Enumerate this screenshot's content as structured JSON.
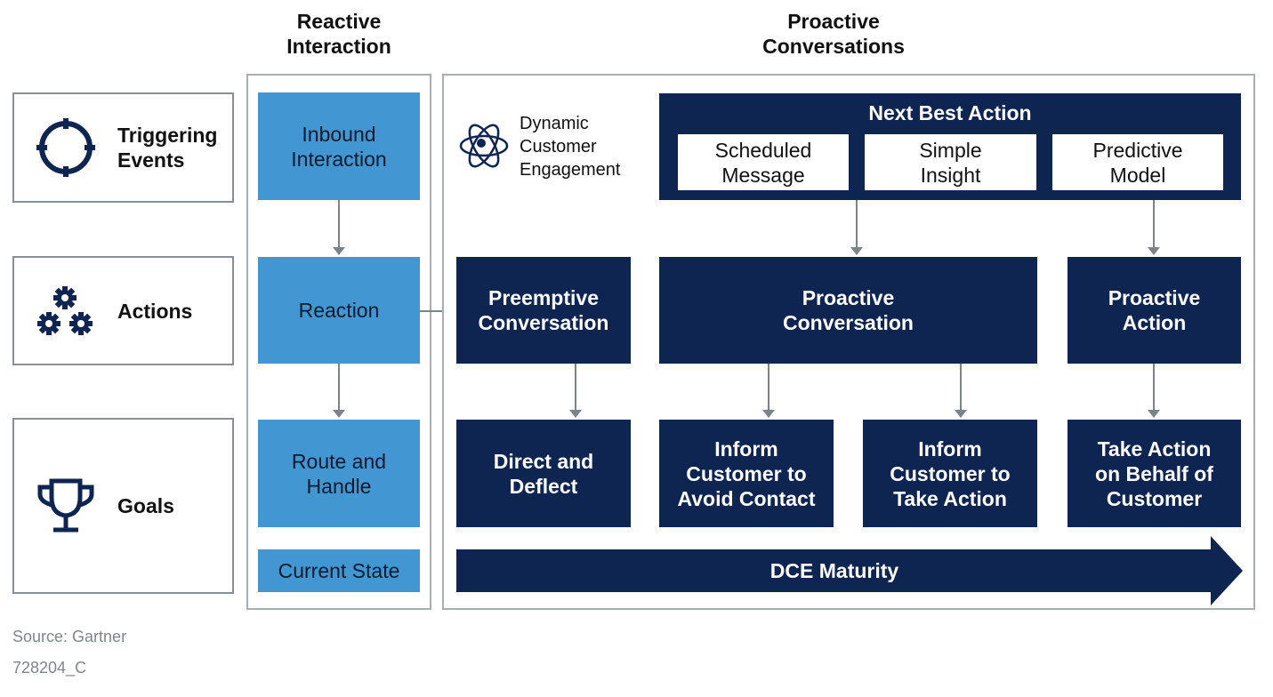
{
  "columns": {
    "reactive": "Reactive\nInteraction",
    "proactive": "Proactive\nConversations"
  },
  "rows": [
    {
      "label": "Triggering\nEvents",
      "icon": "crosshair-target-icon"
    },
    {
      "label": "Actions",
      "icon": "gears-icon"
    },
    {
      "label": "Goals",
      "icon": "trophy-icon"
    }
  ],
  "reactive_boxes": {
    "inbound": "Inbound\nInteraction",
    "reaction": "Reaction",
    "route": "Route and\nHandle",
    "current_state": "Current State"
  },
  "dce": {
    "icon": "atom-icon",
    "label": "Dynamic\nCustomer\nEngagement"
  },
  "next_best_action": {
    "title": "Next Best Action",
    "items": [
      "Scheduled\nMessage",
      "Simple\nInsight",
      "Predictive\nModel"
    ]
  },
  "actions": {
    "preemptive": "Preemptive\nConversation",
    "proactive": "Proactive\nConversation",
    "proactive_action": "Proactive\nAction"
  },
  "goals": {
    "direct": "Direct and\nDeflect",
    "avoid": "Inform\nCustomer to\nAvoid Contact",
    "take": "Inform\nCustomer to\nTake Action",
    "behalf": "Take Action\non Behalf of\nCustomer"
  },
  "maturity_arrow": "DCE Maturity",
  "colors": {
    "navy": "#0e2552",
    "light_blue": "#4296d2",
    "connector_gray": "#7c8487",
    "border_gray": "#a9aeb1"
  },
  "footer": {
    "source": "Source: Gartner",
    "id": "728204_C"
  }
}
